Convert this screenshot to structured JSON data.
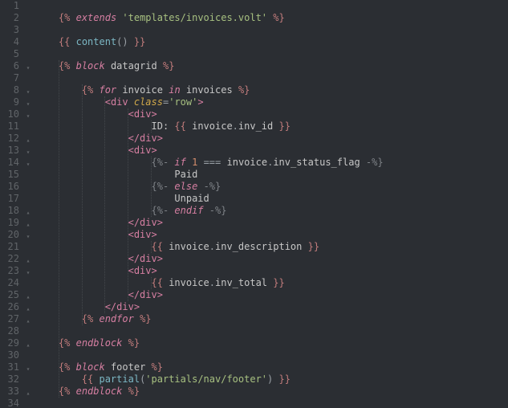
{
  "lines": {
    "2": {
      "extends": "extends",
      "template": "'templates/invoices.volt'"
    },
    "4": {
      "content": "content"
    },
    "6": {
      "block": "block",
      "name": "datagrid"
    },
    "8": {
      "for": "for",
      "var": "invoice",
      "in": "in",
      "coll": "invoices"
    },
    "9": {
      "tag": "div",
      "attr": "class",
      "val": "'row'"
    },
    "10": {
      "tag": "div"
    },
    "11": {
      "label": "ID: ",
      "obj": "invoice",
      "prop": "inv_id"
    },
    "12": {
      "tag": "div"
    },
    "13": {
      "tag": "div"
    },
    "14": {
      "if": "if",
      "num": "1",
      "op": "===",
      "obj": "invoice",
      "prop": "inv_status_flag"
    },
    "15": {
      "text": "Paid"
    },
    "16": {
      "else": "else"
    },
    "17": {
      "text": "Unpaid"
    },
    "18": {
      "endif": "endif"
    },
    "19": {
      "tag": "div"
    },
    "20": {
      "tag": "div"
    },
    "21": {
      "obj": "invoice",
      "prop": "inv_description"
    },
    "22": {
      "tag": "div"
    },
    "23": {
      "tag": "div"
    },
    "24": {
      "obj": "invoice",
      "prop": "inv_total"
    },
    "25": {
      "tag": "div"
    },
    "26": {
      "tag": "div"
    },
    "27": {
      "endfor": "endfor"
    },
    "29": {
      "endblock": "endblock"
    },
    "31": {
      "block": "block",
      "name": "footer"
    },
    "32": {
      "partial": "partial",
      "arg": "'partials/nav/footer'"
    },
    "33": {
      "endblock": "endblock"
    }
  },
  "line_numbers": [
    "1",
    "2",
    "3",
    "4",
    "5",
    "6",
    "7",
    "8",
    "9",
    "10",
    "11",
    "12",
    "13",
    "14",
    "15",
    "16",
    "17",
    "18",
    "19",
    "20",
    "21",
    "22",
    "23",
    "24",
    "25",
    "26",
    "27",
    "28",
    "29",
    "30",
    "31",
    "32",
    "33",
    "34"
  ],
  "folds": [
    {
      "line": 6,
      "sym": "▾"
    },
    {
      "line": 8,
      "sym": "▾"
    },
    {
      "line": 9,
      "sym": "▾"
    },
    {
      "line": 10,
      "sym": "▾"
    },
    {
      "line": 12,
      "sym": "▴"
    },
    {
      "line": 13,
      "sym": "▾"
    },
    {
      "line": 14,
      "sym": "▾"
    },
    {
      "line": 18,
      "sym": "▴"
    },
    {
      "line": 19,
      "sym": "▴"
    },
    {
      "line": 20,
      "sym": "▾"
    },
    {
      "line": 22,
      "sym": "▴"
    },
    {
      "line": 23,
      "sym": "▾"
    },
    {
      "line": 25,
      "sym": "▴"
    },
    {
      "line": 26,
      "sym": "▴"
    },
    {
      "line": 27,
      "sym": "▴"
    },
    {
      "line": 29,
      "sym": "▴"
    },
    {
      "line": 31,
      "sym": "▾"
    },
    {
      "line": 33,
      "sym": "▴"
    }
  ]
}
